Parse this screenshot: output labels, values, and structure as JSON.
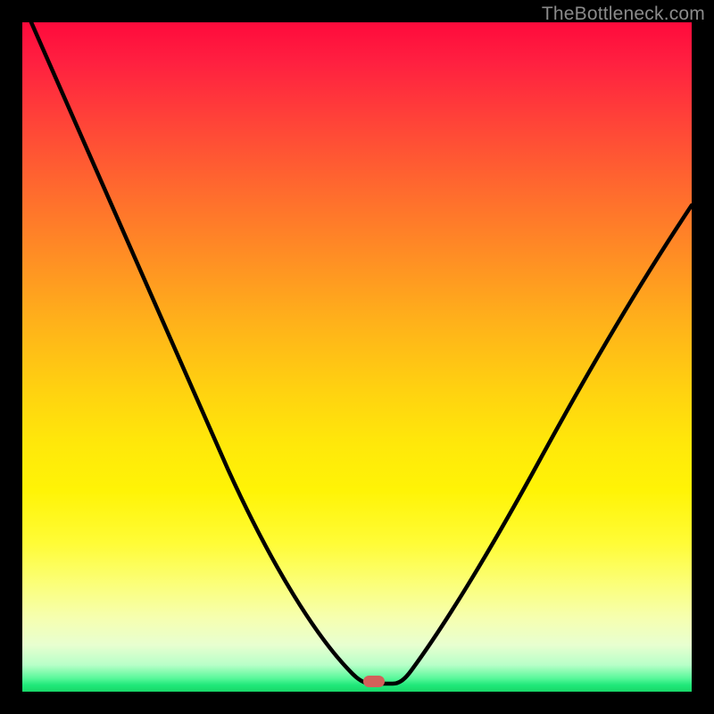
{
  "watermark": "TheBottleneck.com",
  "marker": {
    "x_frac": 0.525,
    "y_frac": 0.985
  },
  "chart_data": {
    "type": "line",
    "title": "",
    "xlabel": "",
    "ylabel": "",
    "xlim": [
      0,
      1
    ],
    "ylim": [
      0,
      1
    ],
    "series": [
      {
        "name": "bottleneck-curve",
        "x": [
          0.0,
          0.05,
          0.1,
          0.15,
          0.2,
          0.25,
          0.3,
          0.35,
          0.4,
          0.45,
          0.48,
          0.5,
          0.52,
          0.55,
          0.57,
          0.6,
          0.65,
          0.7,
          0.75,
          0.8,
          0.85,
          0.9,
          0.95,
          1.0
        ],
        "y": [
          1.0,
          0.88,
          0.76,
          0.65,
          0.55,
          0.45,
          0.36,
          0.28,
          0.2,
          0.12,
          0.06,
          0.02,
          0.01,
          0.01,
          0.03,
          0.08,
          0.18,
          0.28,
          0.38,
          0.47,
          0.55,
          0.62,
          0.68,
          0.73
        ]
      }
    ],
    "gradient_stops": [
      {
        "pos": 0.0,
        "color": "#ff0a3c"
      },
      {
        "pos": 0.5,
        "color": "#ffd210"
      },
      {
        "pos": 0.85,
        "color": "#fbff7a"
      },
      {
        "pos": 1.0,
        "color": "#18d868"
      }
    ],
    "marker": {
      "x": 0.525,
      "y": 0.015,
      "color": "#d2605a"
    }
  }
}
